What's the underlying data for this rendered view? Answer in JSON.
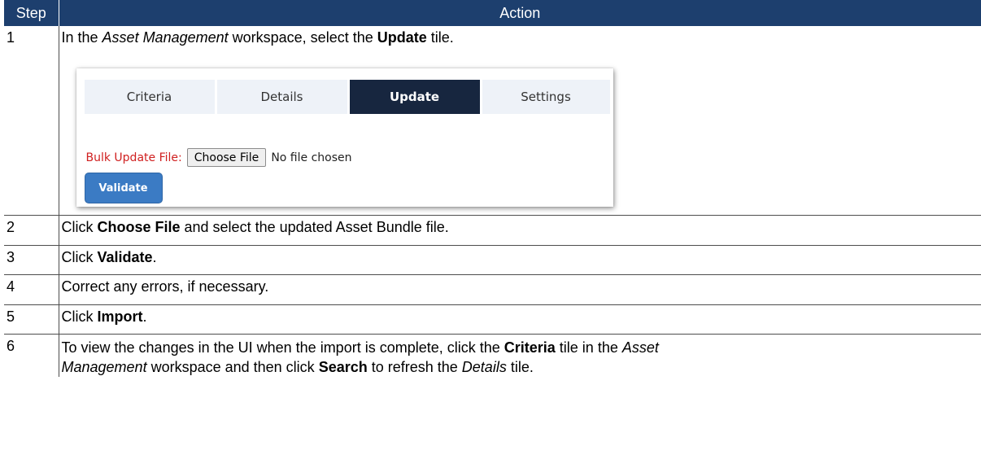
{
  "header": {
    "step": "Step",
    "action": "Action"
  },
  "rows": [
    {
      "step": "1",
      "parts": [
        "In the ",
        "Asset Management",
        " workspace, select the ",
        "Update",
        " tile."
      ]
    },
    {
      "step": "2",
      "parts": [
        "Click ",
        "Choose File",
        " and select the updated Asset Bundle file."
      ]
    },
    {
      "step": "3",
      "parts": [
        "Click ",
        "Validate",
        "."
      ]
    },
    {
      "step": "4",
      "parts": [
        "Correct any errors, if necessary."
      ]
    },
    {
      "step": "5",
      "parts": [
        "Click ",
        "Import",
        "."
      ]
    },
    {
      "step": "6",
      "line1": [
        "To view the changes in the UI when the import is complete, click the ",
        "Criteria",
        " tile in the ",
        "Asset"
      ],
      "line2": [
        "Management",
        " workspace and then click ",
        "Search",
        " to refresh the ",
        "Details",
        " tile."
      ]
    }
  ],
  "screenshot": {
    "tabs": [
      "Criteria",
      "Details",
      "Update",
      "Settings"
    ],
    "active_tab": "Update",
    "file_label": "Bulk Update File:",
    "choose_button": "Choose File",
    "no_file_text": "No file chosen",
    "validate_button": "Validate"
  },
  "colors": {
    "header_bg": "#1d3f6e",
    "active_tab_bg": "#17263f",
    "tab_bg": "#eef2f8",
    "label_red": "#d02020",
    "validate_blue": "#3b7bc4"
  }
}
